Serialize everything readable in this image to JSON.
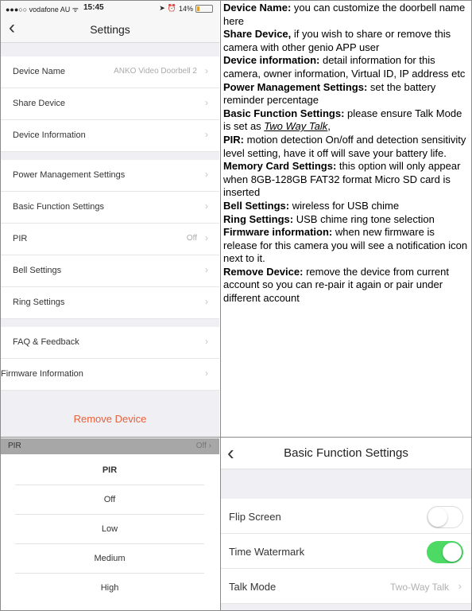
{
  "settings_screen": {
    "status_bar": {
      "carrier": "●●●○○ vodafone AU ᯤ",
      "time": "15:45",
      "battery": "14%"
    },
    "title": "Settings",
    "rows": [
      {
        "label": "Device Name",
        "value": "ANKO Video Doorbell 2"
      },
      {
        "label": "Share Device"
      },
      {
        "label": "Device Information"
      },
      {
        "label": "Power Management Settings"
      },
      {
        "label": "Basic Function Settings"
      },
      {
        "label": "PIR",
        "value": "Off"
      },
      {
        "label": "Bell Settings"
      },
      {
        "label": "Ring Settings"
      },
      {
        "label": "FAQ & Feedback"
      },
      {
        "label": "Firmware Information"
      }
    ],
    "remove_label": "Remove Device"
  },
  "descriptions": [
    {
      "term": "Device Name:",
      "text": " you can customize the doorbell name here"
    },
    {
      "term": "Share Device,",
      "text": " if you wish to share or remove  this camera with other genio APP user"
    },
    {
      "term": "Device information:",
      "text": " detail information for this camera, owner information, Virtual ID, IP address etc"
    },
    {
      "term": "Power Management Settings:",
      "text": "  set the battery reminder percentage"
    },
    {
      "term": "Basic Function Settings:",
      "text": " please ensure  Talk Mode is set as ",
      "emph": "Two Way Talk",
      "after": ","
    },
    {
      "term": "PIR:",
      "text": " motion detection On/off and detection sensitivity level setting, have it off will save your battery life."
    },
    {
      "term": "Memory Card Settings:",
      "text": " this option will only appear when 8GB-128GB FAT32 format Micro SD card is inserted"
    },
    {
      "term": "Bell Settings:",
      "text": " wireless for USB chime"
    },
    {
      "term": "Ring Settings:",
      "text": " USB chime ring tone selection"
    },
    {
      "term": "Firmware information:",
      "text": " when new firmware is release for this camera you will see a notification icon next to it."
    },
    {
      "term": "Remove Device:",
      "text": " remove the device from current account so you can re-pair it again or pair under different account"
    }
  ],
  "pir_picker": {
    "header_label": "PIR",
    "header_value": "Off",
    "title": "PIR",
    "options": [
      "Off",
      "Low",
      "Medium",
      "High"
    ]
  },
  "basic_function": {
    "title": "Basic Function Settings",
    "rows": [
      {
        "label": "Flip Screen",
        "state": "off"
      },
      {
        "label": "Time Watermark",
        "state": "on"
      },
      {
        "label": "Talk Mode",
        "value": "Two-Way Talk"
      }
    ]
  },
  "colors": {
    "accent_remove": "#e8613a",
    "toggle_on": "#4cd964",
    "background": "#efeff4"
  }
}
